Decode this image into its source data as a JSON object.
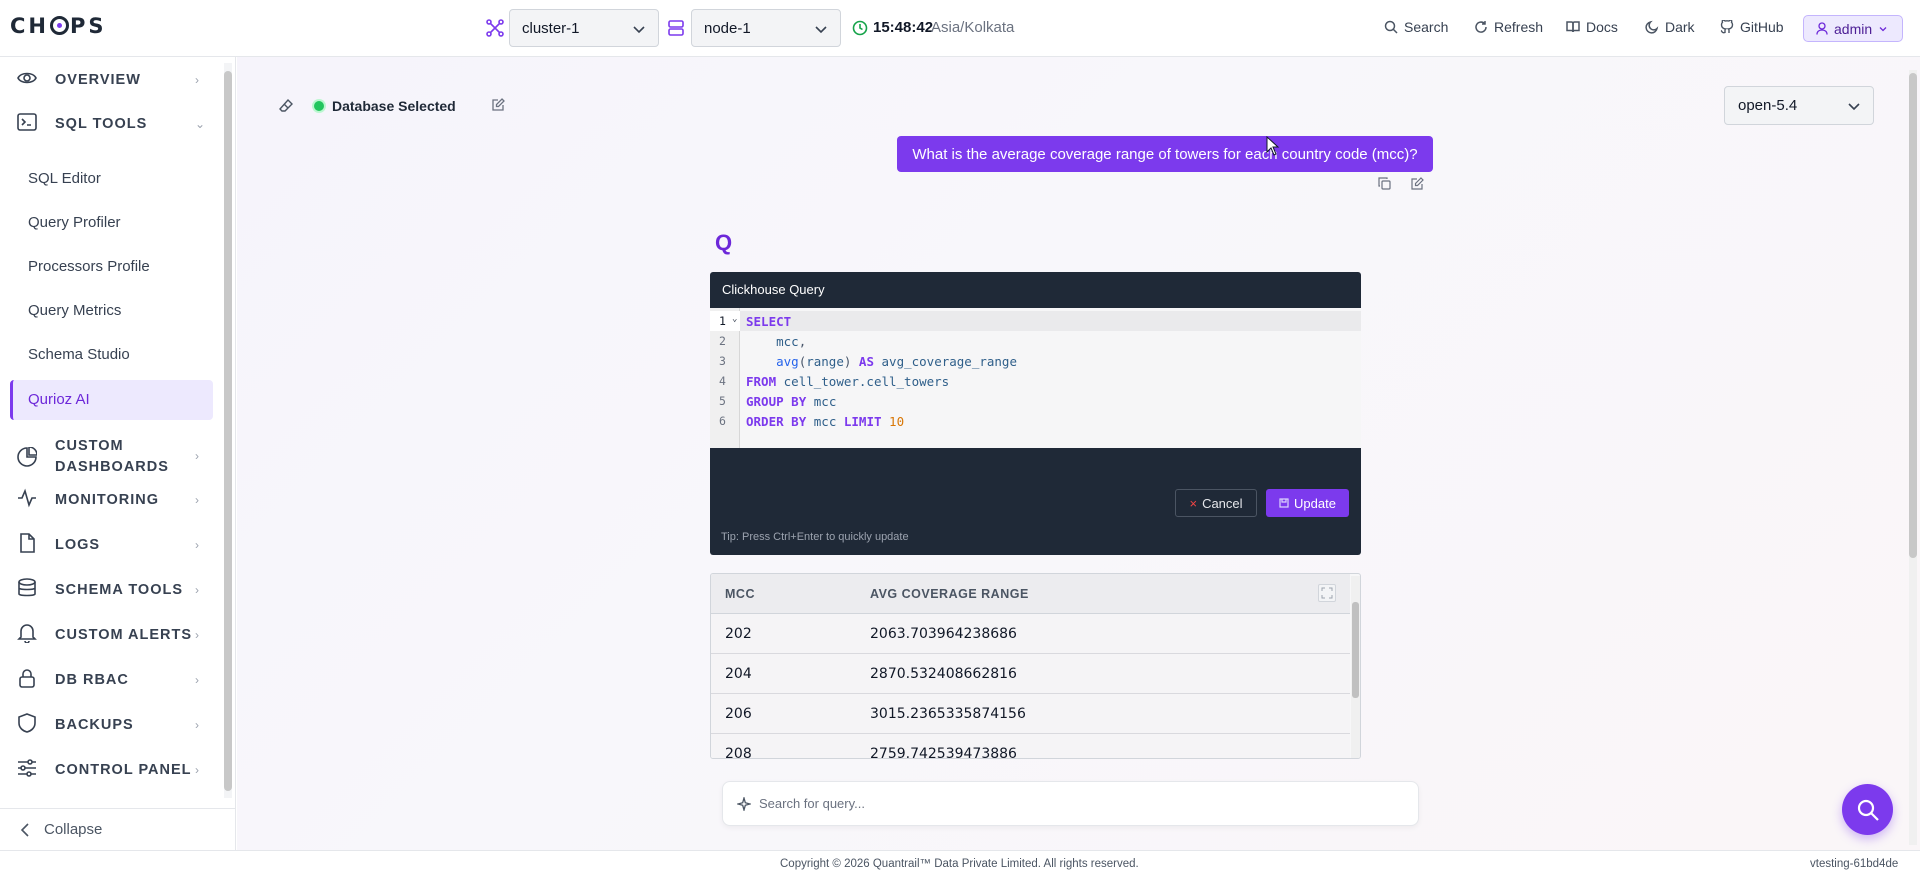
{
  "header": {
    "logo": "CHOPS",
    "cluster_value": "cluster-1",
    "node_value": "node-1",
    "time": "15:48:42",
    "timezone": "Asia/Kolkata",
    "links": {
      "search": "Search",
      "refresh": "Refresh",
      "docs": "Docs",
      "dark": "Dark",
      "github": "GitHub"
    },
    "user": "admin"
  },
  "sidebar": {
    "sections": [
      {
        "label": "OVERVIEW",
        "icon": "eye-icon"
      },
      {
        "label": "SQL TOOLS",
        "icon": "terminal-icon"
      },
      {
        "label": "CUSTOM DASHBOARDS",
        "icon": "pie-chart-icon"
      },
      {
        "label": "MONITORING",
        "icon": "activity-icon"
      },
      {
        "label": "LOGS",
        "icon": "file-icon"
      },
      {
        "label": "SCHEMA TOOLS",
        "icon": "database-icon"
      },
      {
        "label": "CUSTOM ALERTS",
        "icon": "bell-icon"
      },
      {
        "label": "DB RBAC",
        "icon": "lock-icon"
      },
      {
        "label": "BACKUPS",
        "icon": "shield-icon"
      },
      {
        "label": "CONTROL PANEL",
        "icon": "sliders-icon"
      }
    ],
    "sql_items": [
      "SQL Editor",
      "Query Profiler",
      "Processors Profile",
      "Query Metrics",
      "Schema Studio",
      "Qurioz AI"
    ],
    "active_item": "Qurioz AI",
    "collapse_label": "Collapse"
  },
  "main": {
    "db_status": "Database Selected",
    "model_value": "open-5.4",
    "question": "What is the average coverage range of towers for each country code (mcc)?",
    "assistant_mark": "Q",
    "code_title": "Clickhouse Query",
    "line_numbers": [
      "1",
      "2",
      "3",
      "4",
      "5",
      "6"
    ],
    "code_lines": [
      "SELECT",
      "    mcc,",
      "    avg(range) AS avg_coverage_range",
      "FROM cell_tower.cell_towers",
      "GROUP BY mcc",
      "ORDER BY mcc LIMIT 10"
    ],
    "cancel_label": "Cancel",
    "update_label": "Update",
    "tip": "Tip: Press Ctrl+Enter to quickly update",
    "table": {
      "columns": [
        "MCC",
        "AVG COVERAGE RANGE"
      ],
      "rows": [
        [
          "202",
          "2063.703964238686"
        ],
        [
          "204",
          "2870.532408662816"
        ],
        [
          "206",
          "3015.2365335874156"
        ],
        [
          "208",
          "2759.742539473886"
        ]
      ]
    },
    "search_placeholder": "Search for query..."
  },
  "footer": {
    "copyright": "Copyright © 2026 Quantrail™ Data Private Limited. All rights reserved.",
    "version": "vtesting-61bd4de"
  },
  "colors": {
    "accent": "#7c3aed",
    "dark_panel": "#1f2937",
    "status_green": "#22c55e"
  }
}
